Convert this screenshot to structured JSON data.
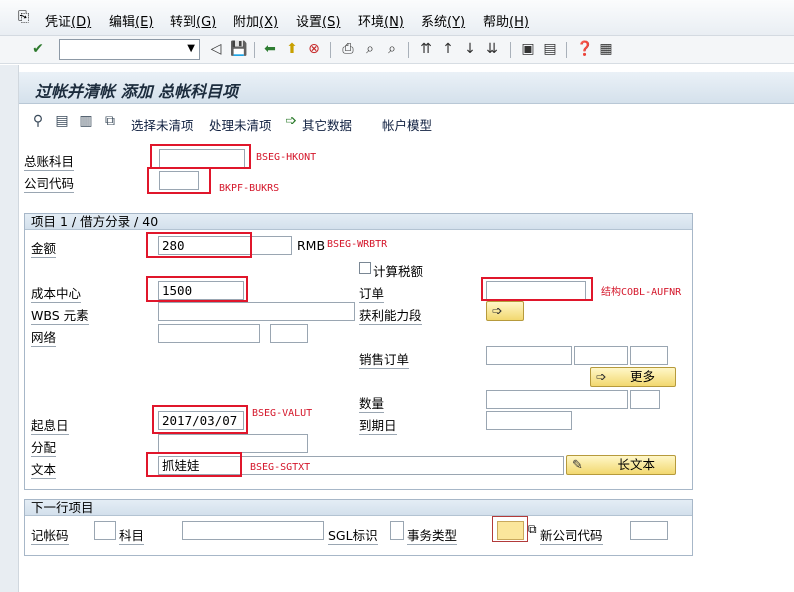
{
  "menu": [
    {
      "label": "凭证",
      "mnemonic": "(D)"
    },
    {
      "label": "编辑",
      "mnemonic": "(E)"
    },
    {
      "label": "转到",
      "mnemonic": "(G)"
    },
    {
      "label": "附加",
      "mnemonic": "(X)"
    },
    {
      "label": "设置",
      "mnemonic": "(S)"
    },
    {
      "label": "环境",
      "mnemonic": "(N)"
    },
    {
      "label": "系统",
      "mnemonic": "(Y)"
    },
    {
      "label": "帮助",
      "mnemonic": "(H)"
    }
  ],
  "toolbar": {
    "command_value": "",
    "dropdown_glyph": "▼"
  },
  "title": "过帐并清帐 添加 总帐科目项",
  "app_toolbar": {
    "open_items_select": "选择未清项",
    "open_items_process": "处理未清项",
    "other_data": "其它数据",
    "account_model": "帐户模型"
  },
  "header": {
    "gl_account_label": "总账科目",
    "gl_account_value": "",
    "gl_account_ann": "BSEG-HKONT",
    "company_code_label": "公司代码",
    "company_code_value": "",
    "company_code_ann": "BKPF-BUKRS"
  },
  "item": {
    "group_title": "项目 1 / 借方分录 / 40",
    "amount_label": "金额",
    "amount_value": "280",
    "currency": "RMB",
    "amount_ann": "BSEG-WRBTR",
    "calc_tax_label": "计算税额",
    "cost_center_label": "成本中心",
    "cost_center_value": "1500",
    "order_label": "订单",
    "order_value": "",
    "order_ann": "结构COBL-AUFNR",
    "wbs_label": "WBS 元素",
    "profit_segment_label": "获利能力段",
    "network_label": "网络",
    "sales_order_label": "销售订单",
    "more_button": "更多",
    "quantity_label": "数量",
    "value_date_label": "起息日",
    "value_date_value": "2017/03/07",
    "value_date_ann": "BSEG-VALUT",
    "due_date_label": "到期日",
    "assignment_label": "分配",
    "text_label": "文本",
    "text_value": "抓娃娃",
    "text_ann": "BSEG-SGTXT",
    "long_text_button": "长文本"
  },
  "next_item": {
    "group_title": "下一行项目",
    "posting_key_label": "记帐码",
    "account_label": "科目",
    "sgl_label": "SGL标识",
    "transaction_type_label": "事务类型",
    "new_company_code_label": "新公司代码"
  },
  "colors": {
    "annotation": "#d4162a",
    "highlight_box": "#e0162b",
    "button": "#f2d870"
  }
}
